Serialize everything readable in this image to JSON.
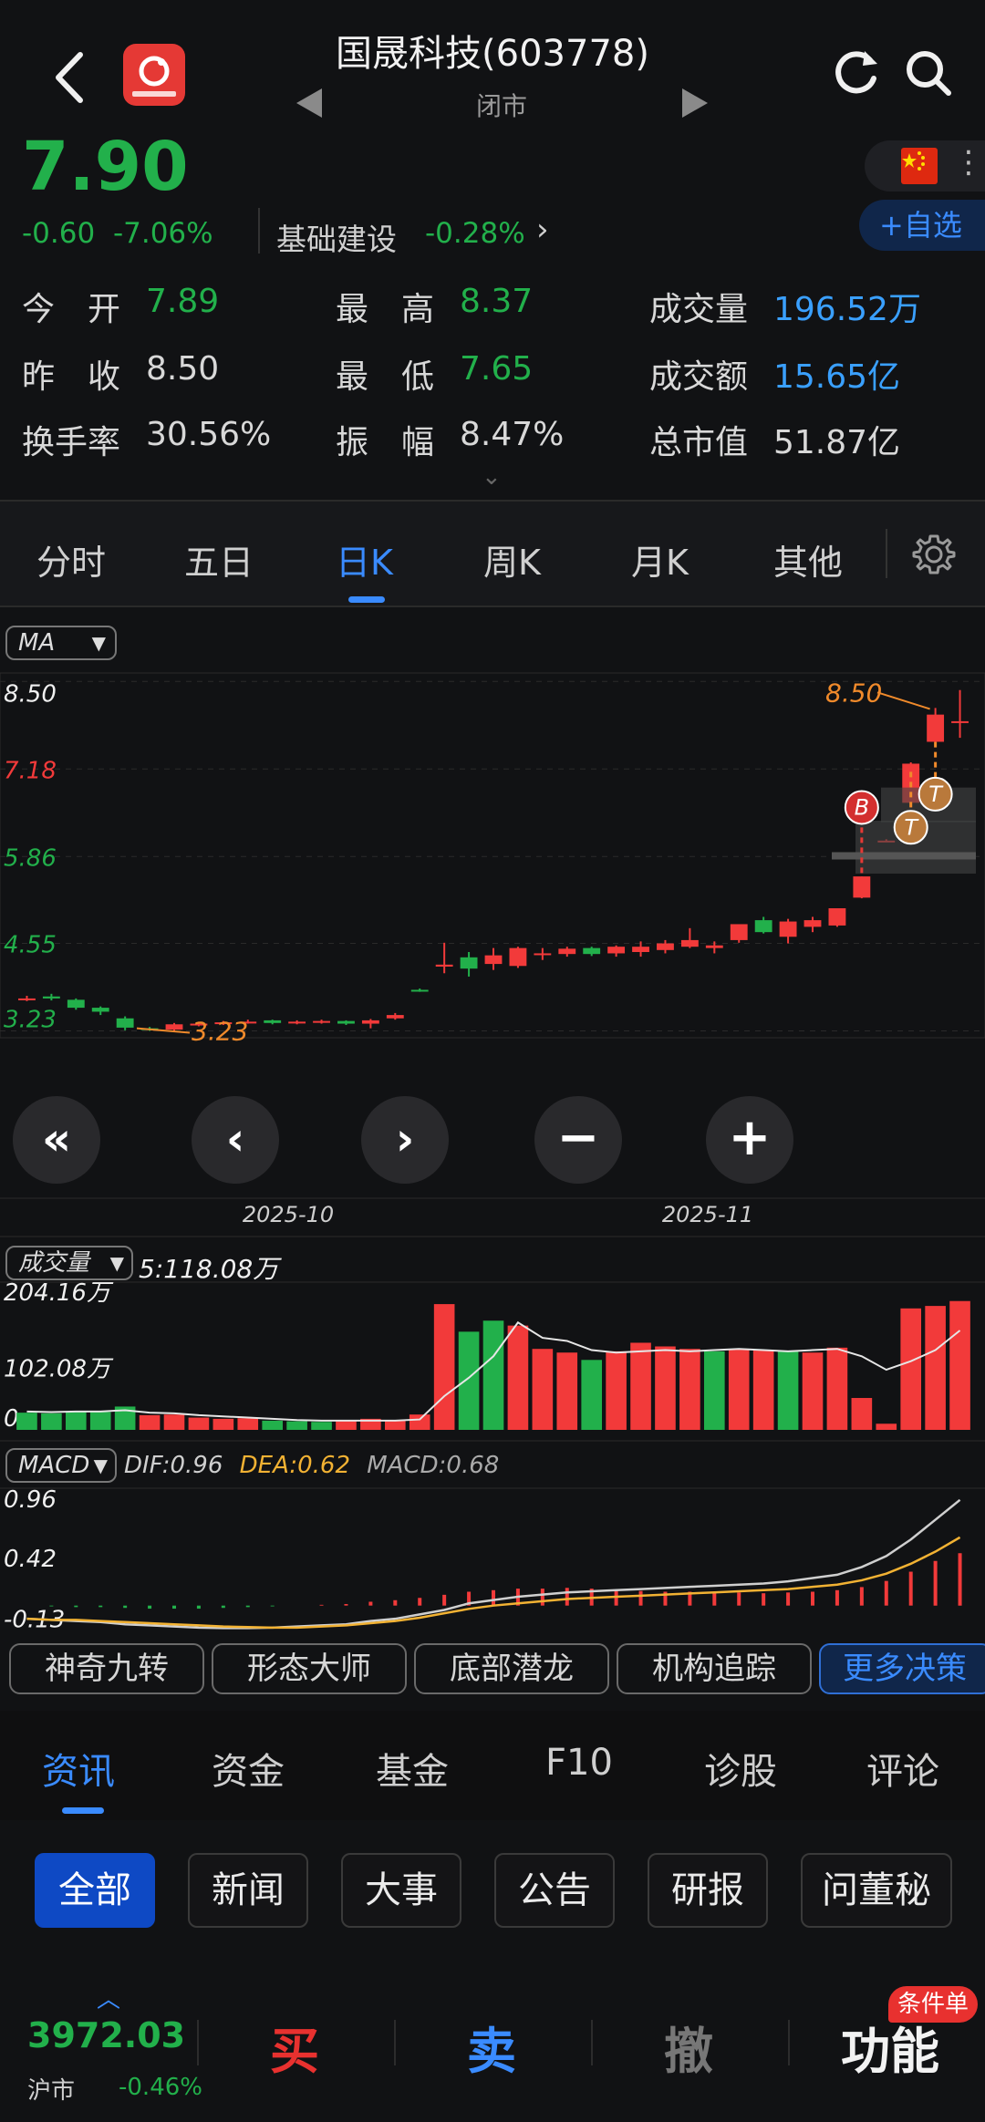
{
  "header": {
    "title": "国晟科技(603778)",
    "status": "闭市",
    "icons": [
      "back-icon",
      "app-logo",
      "prev-arrow-icon",
      "next-arrow-icon",
      "refresh-icon",
      "search-icon"
    ]
  },
  "quote": {
    "price": "7.90",
    "change": "-0.60",
    "change_pct": "-7.06%",
    "sector_name": "基础建设",
    "sector_change": "-0.28%",
    "watch_label": "+自选",
    "flag_icon": "china-flag-icon"
  },
  "stats": [
    {
      "label": "今　开",
      "value": "7.89",
      "color": "green"
    },
    {
      "label": "最　高",
      "value": "8.37",
      "color": "green"
    },
    {
      "label": "成交量",
      "value": "196.52万",
      "color": "blue"
    },
    {
      "label": "昨　收",
      "value": "8.50",
      "color": "plain"
    },
    {
      "label": "最　低",
      "value": "7.65",
      "color": "green"
    },
    {
      "label": "成交额",
      "value": "15.65亿",
      "color": "blue"
    },
    {
      "label": "换手率",
      "value": "30.56%",
      "color": "plain"
    },
    {
      "label": "振　幅",
      "value": "8.47%",
      "color": "plain"
    },
    {
      "label": "总市值",
      "value": "51.87亿",
      "color": "plain"
    }
  ],
  "chart_tabs": [
    "分时",
    "五日",
    "日K",
    "周K",
    "月K",
    "其他"
  ],
  "chart_tabs_active": "日K",
  "main_chart": {
    "indicator": "MA",
    "y_ticks": [
      "8.50",
      "7.18",
      "5.86",
      "4.55",
      "3.23"
    ],
    "x_ticks": [
      "2025-10",
      "2025-11"
    ],
    "high_label": "8.50",
    "low_label": "3.23",
    "markers": [
      "B",
      "T",
      "T"
    ]
  },
  "volume_panel": {
    "indicator": "成交量",
    "ma_label": "5:118.08万",
    "y_ticks": [
      "204.16万",
      "102.08万",
      "0"
    ]
  },
  "macd_panel": {
    "indicator": "MACD",
    "dif": "DIF:0.96",
    "dea": "DEA:0.62",
    "macd": "MACD:0.68",
    "y_ticks": [
      "0.96",
      "0.42",
      "-0.13"
    ]
  },
  "nav_controls": [
    "rewind-icon",
    "prev-icon",
    "next-icon",
    "zoom-out-icon",
    "zoom-in-icon"
  ],
  "strategies": [
    "神奇九转",
    "形态大师",
    "底部潜龙",
    "机构追踪",
    "更多决策"
  ],
  "news_tabs": [
    "资讯",
    "资金",
    "基金",
    "F10",
    "诊股",
    "评论"
  ],
  "news_tabs_active": "资讯",
  "filter_chips": [
    "全部",
    "新闻",
    "大事",
    "公告",
    "研报",
    "问董秘"
  ],
  "filter_active": "全部",
  "trade_bar": {
    "index_value": "3972.03",
    "index_name": "沪市",
    "index_change": "-0.46%",
    "buy": "买",
    "sell": "卖",
    "cancel": "撤",
    "func": "功能",
    "badge": "条件单"
  },
  "chart_data": [
    {
      "type": "candlestick",
      "title": "",
      "y_ticks": [
        8.5,
        7.18,
        5.86,
        4.55,
        3.23
      ],
      "ylim": [
        3.1,
        8.6
      ],
      "x_ticks": [
        "2025-10",
        "2025-11"
      ],
      "candles": [
        {
          "o": 3.72,
          "h": 3.76,
          "l": 3.68,
          "c": 3.72
        },
        {
          "o": 3.75,
          "h": 3.79,
          "l": 3.69,
          "c": 3.72
        },
        {
          "o": 3.7,
          "h": 3.72,
          "l": 3.55,
          "c": 3.58
        },
        {
          "o": 3.58,
          "h": 3.6,
          "l": 3.47,
          "c": 3.52
        },
        {
          "o": 3.42,
          "h": 3.45,
          "l": 3.24,
          "c": 3.28
        },
        {
          "o": 3.27,
          "h": 3.29,
          "l": 3.23,
          "c": 3.25
        },
        {
          "o": 3.25,
          "h": 3.35,
          "l": 3.23,
          "c": 3.33
        },
        {
          "o": 3.33,
          "h": 3.37,
          "l": 3.3,
          "c": 3.34
        },
        {
          "o": 3.34,
          "h": 3.38,
          "l": 3.32,
          "c": 3.36
        },
        {
          "o": 3.36,
          "h": 3.4,
          "l": 3.34,
          "c": 3.37
        },
        {
          "o": 3.39,
          "h": 3.4,
          "l": 3.33,
          "c": 3.35
        },
        {
          "o": 3.35,
          "h": 3.39,
          "l": 3.33,
          "c": 3.37
        },
        {
          "o": 3.37,
          "h": 3.4,
          "l": 3.34,
          "c": 3.38
        },
        {
          "o": 3.38,
          "h": 3.39,
          "l": 3.32,
          "c": 3.34
        },
        {
          "o": 3.34,
          "h": 3.41,
          "l": 3.27,
          "c": 3.39
        },
        {
          "o": 3.42,
          "h": 3.5,
          "l": 3.4,
          "c": 3.47
        },
        {
          "o": 3.85,
          "h": 3.87,
          "l": 3.82,
          "c": 3.84
        },
        {
          "o": 4.2,
          "h": 4.56,
          "l": 4.1,
          "c": 4.23
        },
        {
          "o": 4.34,
          "h": 4.42,
          "l": 4.05,
          "c": 4.17
        },
        {
          "o": 4.24,
          "h": 4.48,
          "l": 4.15,
          "c": 4.37
        },
        {
          "o": 4.21,
          "h": 4.5,
          "l": 4.18,
          "c": 4.48
        },
        {
          "o": 4.38,
          "h": 4.48,
          "l": 4.3,
          "c": 4.4
        },
        {
          "o": 4.39,
          "h": 4.5,
          "l": 4.35,
          "c": 4.47
        },
        {
          "o": 4.48,
          "h": 4.5,
          "l": 4.36,
          "c": 4.39
        },
        {
          "o": 4.4,
          "h": 4.52,
          "l": 4.35,
          "c": 4.5
        },
        {
          "o": 4.42,
          "h": 4.58,
          "l": 4.35,
          "c": 4.5
        },
        {
          "o": 4.45,
          "h": 4.6,
          "l": 4.4,
          "c": 4.55
        },
        {
          "o": 4.5,
          "h": 4.78,
          "l": 4.48,
          "c": 4.6
        },
        {
          "o": 4.48,
          "h": 4.58,
          "l": 4.4,
          "c": 4.52
        },
        {
          "o": 4.6,
          "h": 4.82,
          "l": 4.56,
          "c": 4.84
        },
        {
          "o": 4.9,
          "h": 4.95,
          "l": 4.7,
          "c": 4.72
        },
        {
          "o": 4.65,
          "h": 4.92,
          "l": 4.55,
          "c": 4.88
        },
        {
          "o": 4.8,
          "h": 4.95,
          "l": 4.72,
          "c": 4.9
        },
        {
          "o": 4.82,
          "h": 5.08,
          "l": 4.8,
          "c": 5.08
        },
        {
          "o": 5.24,
          "h": 5.56,
          "l": 5.23,
          "c": 5.56
        },
        {
          "o": 6.1,
          "h": 6.12,
          "l": 6.08,
          "c": 6.1
        },
        {
          "o": 6.67,
          "h": 7.28,
          "l": 6.6,
          "c": 7.26
        },
        {
          "o": 7.59,
          "h": 8.1,
          "l": 7.55,
          "c": 8.0
        },
        {
          "o": 7.89,
          "h": 8.37,
          "l": 7.65,
          "c": 7.9
        }
      ]
    },
    {
      "type": "bar",
      "title": "成交量",
      "y_ticks": [
        "204.16万",
        "102.08万",
        "0"
      ],
      "ylim": [
        0,
        220
      ],
      "values": [
        28,
        27,
        30,
        29,
        38,
        24,
        25,
        20,
        18,
        19,
        15,
        14,
        13,
        15,
        18,
        16,
        25,
        205,
        160,
        178,
        170,
        132,
        126,
        114,
        128,
        142,
        136,
        132,
        128,
        132,
        130,
        128,
        126,
        134,
        52,
        10,
        198,
        202,
        210
      ],
      "colors": [
        "g",
        "g",
        "g",
        "g",
        "g",
        "r",
        "r",
        "r",
        "r",
        "r",
        "g",
        "g",
        "g",
        "r",
        "r",
        "r",
        "r",
        "r",
        "g",
        "g",
        "r",
        "r",
        "r",
        "g",
        "r",
        "r",
        "r",
        "r",
        "g",
        "r",
        "r",
        "g",
        "r",
        "r",
        "r",
        "r",
        "r",
        "r",
        "r"
      ],
      "ma5": [
        30,
        29,
        30,
        30,
        32,
        28,
        27,
        24,
        22,
        20,
        18,
        16,
        15,
        15,
        15,
        15,
        17,
        55,
        85,
        120,
        175,
        150,
        145,
        130,
        126,
        128,
        130,
        128,
        130,
        132,
        130,
        128,
        130,
        132,
        120,
        98,
        112,
        130,
        162
      ]
    },
    {
      "type": "macd",
      "title": "MACD",
      "y_ticks": [
        0.96,
        0.42,
        -0.13
      ],
      "ylim": [
        -0.16,
        1.0
      ],
      "dif": [
        -0.12,
        -0.13,
        -0.14,
        -0.15,
        -0.17,
        -0.18,
        -0.19,
        -0.2,
        -0.205,
        -0.205,
        -0.2,
        -0.19,
        -0.18,
        -0.17,
        -0.14,
        -0.12,
        -0.08,
        -0.04,
        0.02,
        0.05,
        0.08,
        0.1,
        0.12,
        0.13,
        0.14,
        0.15,
        0.16,
        0.17,
        0.18,
        0.19,
        0.2,
        0.22,
        0.25,
        0.28,
        0.35,
        0.45,
        0.6,
        0.78,
        0.96
      ],
      "dea": [
        -0.12,
        -0.13,
        -0.13,
        -0.14,
        -0.15,
        -0.16,
        -0.17,
        -0.18,
        -0.19,
        -0.195,
        -0.2,
        -0.2,
        -0.19,
        -0.18,
        -0.16,
        -0.14,
        -0.11,
        -0.07,
        -0.03,
        0.0,
        0.02,
        0.04,
        0.06,
        0.07,
        0.08,
        0.09,
        0.1,
        0.11,
        0.12,
        0.13,
        0.14,
        0.15,
        0.17,
        0.19,
        0.23,
        0.29,
        0.38,
        0.49,
        0.62
      ],
      "macd": [
        0.0,
        -0.01,
        -0.02,
        -0.02,
        -0.03,
        -0.04,
        -0.04,
        -0.04,
        -0.03,
        -0.02,
        -0.01,
        0.0,
        0.01,
        0.02,
        0.05,
        0.07,
        0.1,
        0.14,
        0.18,
        0.2,
        0.22,
        0.22,
        0.23,
        0.22,
        0.2,
        0.19,
        0.18,
        0.18,
        0.17,
        0.17,
        0.16,
        0.17,
        0.18,
        0.2,
        0.24,
        0.32,
        0.44,
        0.58,
        0.68
      ]
    }
  ]
}
